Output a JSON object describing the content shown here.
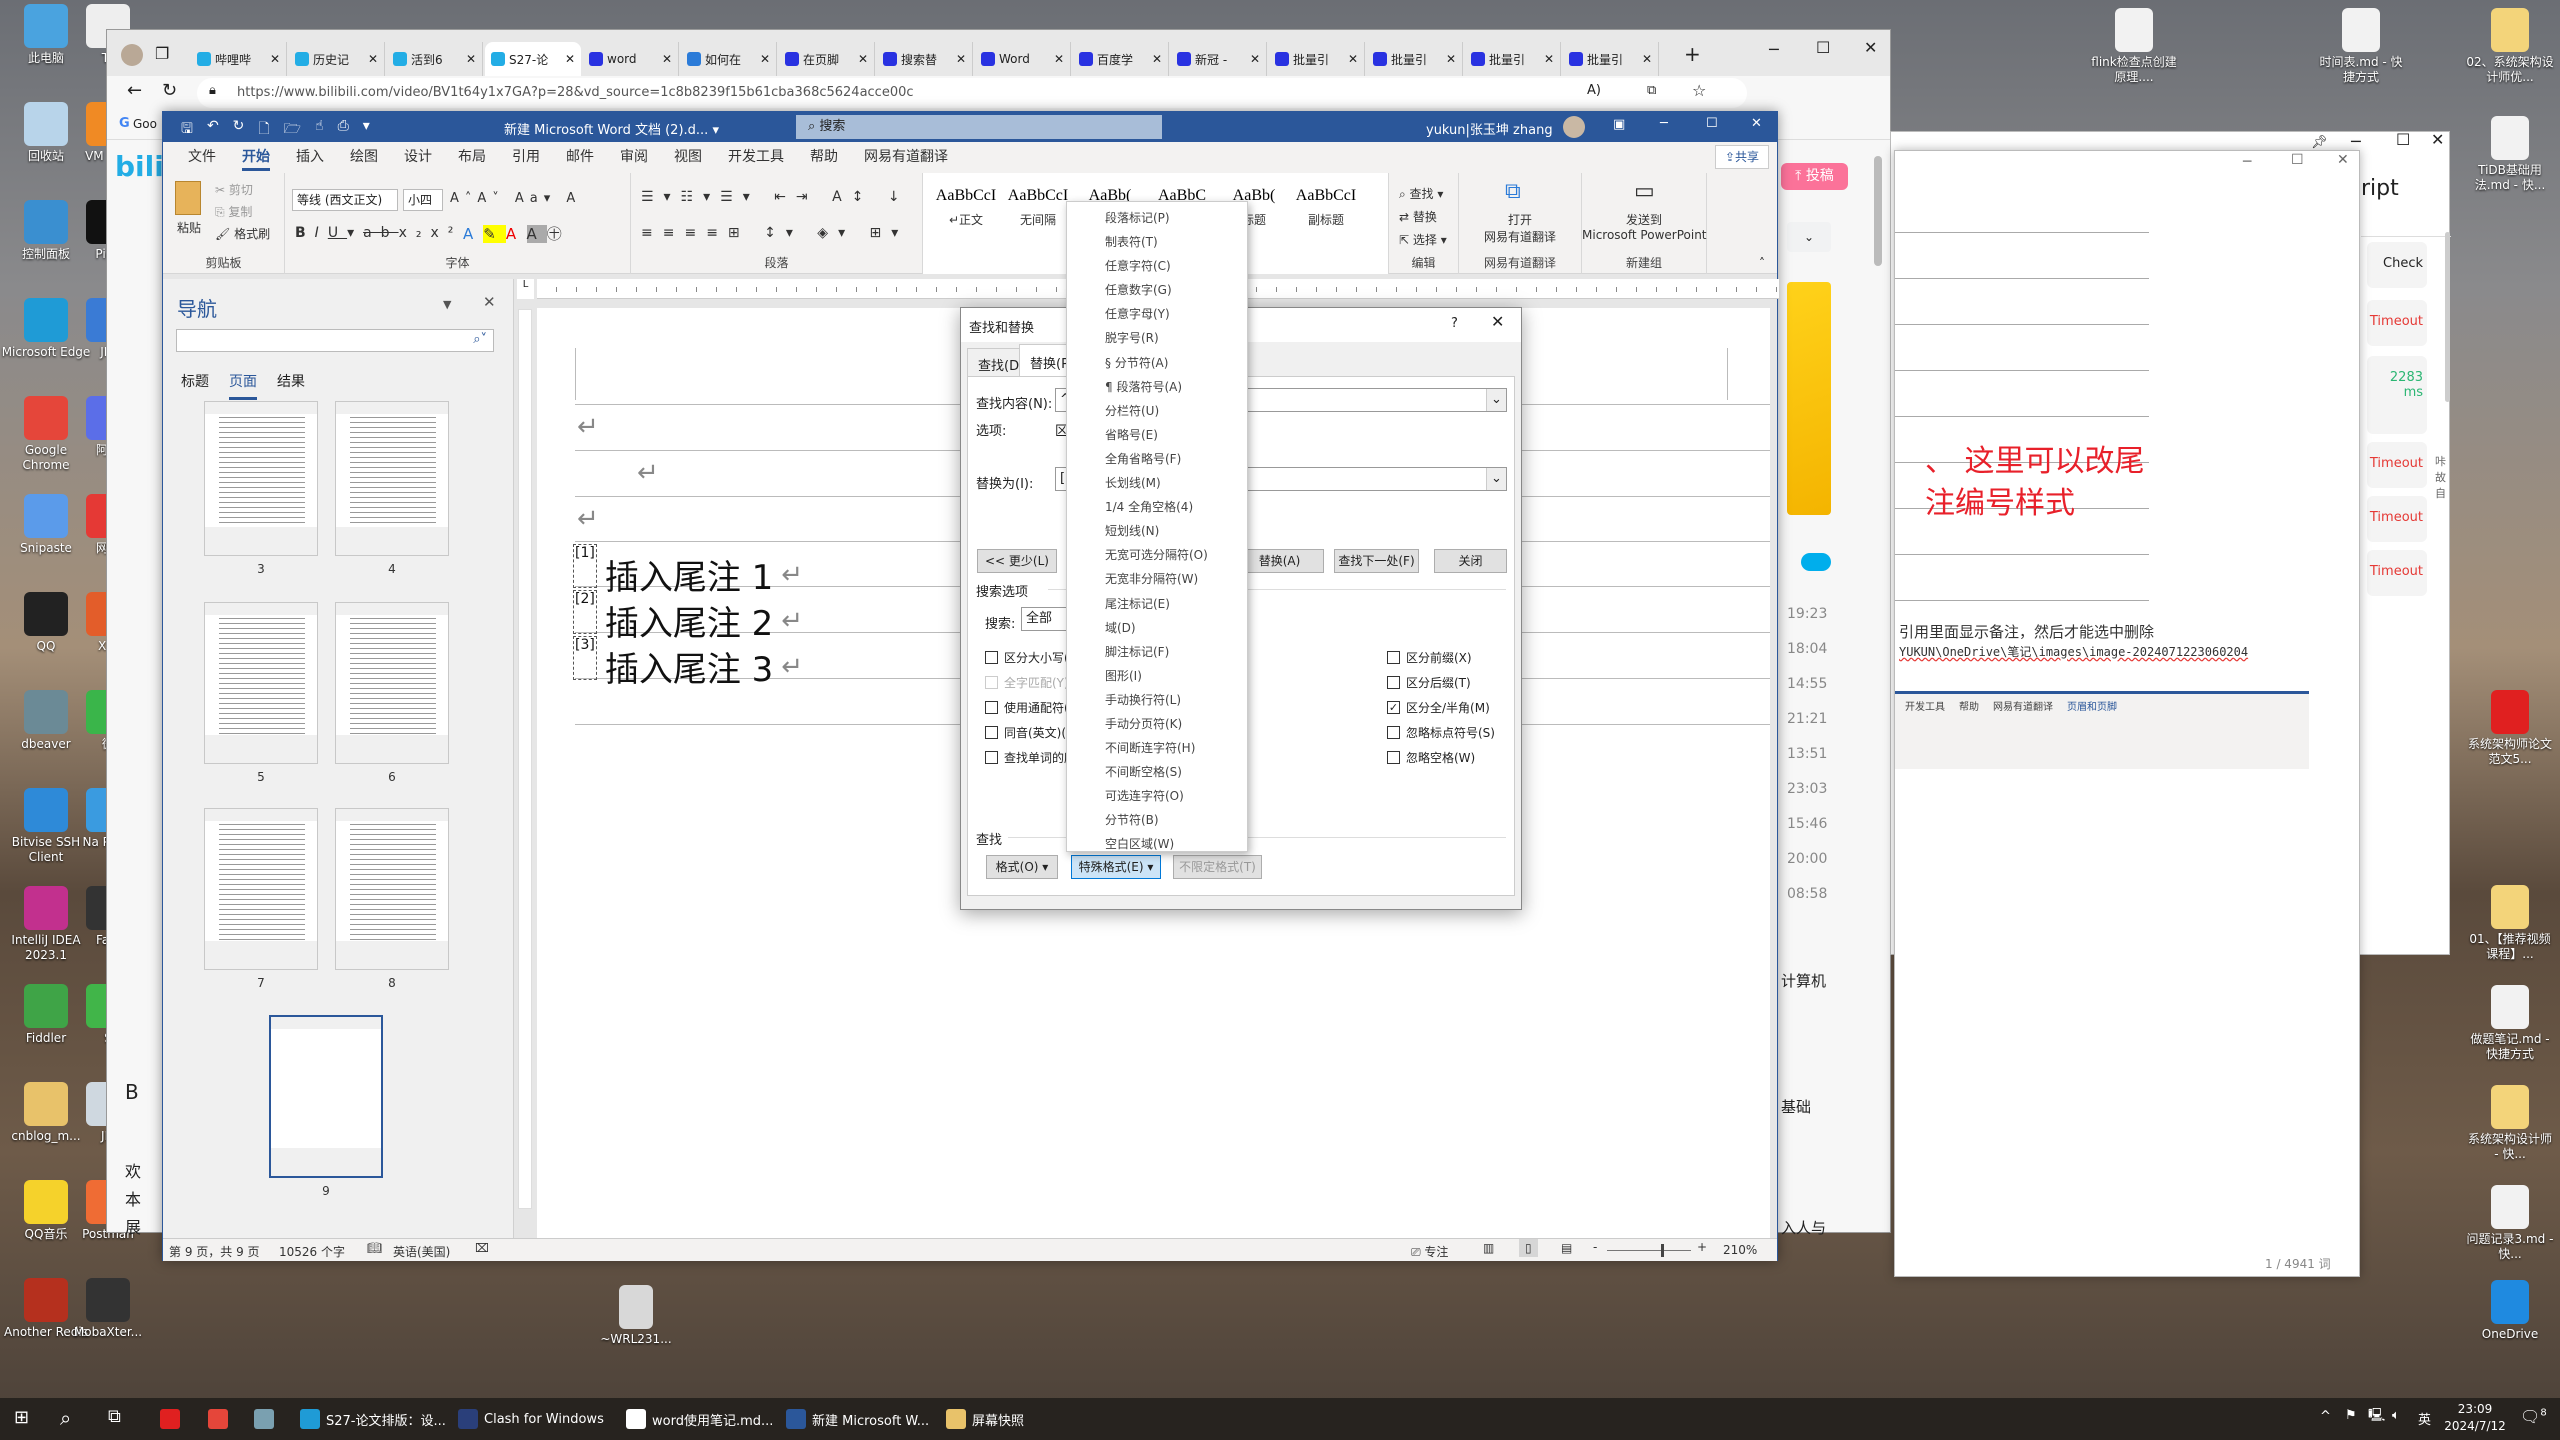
{
  "desktop": {
    "left_icons": [
      {
        "label": "此电脑",
        "color": "#4aa3df"
      },
      {
        "label": "回收站",
        "color": "#b8d4ea"
      },
      {
        "label": "控制面板",
        "color": "#3a8fd0"
      },
      {
        "label": "Microsoft Edge",
        "color": "#1f9bd6"
      },
      {
        "label": "Google Chrome",
        "color": "#e5463a"
      },
      {
        "label": "Snipaste",
        "color": "#5b9bea"
      },
      {
        "label": "QQ",
        "color": "#222222"
      },
      {
        "label": "dbeaver",
        "color": "#6b8a96"
      },
      {
        "label": "Bitvise SSH Client",
        "color": "#2e8ad8"
      },
      {
        "label": "IntelliJ IDEA 2023.1",
        "color": "#c2308e"
      },
      {
        "label": "Fiddler",
        "color": "#3fa447"
      },
      {
        "label": "cnblog_m...",
        "color": "#e8c26a"
      },
      {
        "label": "QQ音乐",
        "color": "#f5d22b"
      },
      {
        "label": "Another Redis",
        "color": "#b5301e"
      }
    ],
    "left_icons_col2": [
      {
        "label": "Ty",
        "color": "#eeeeee"
      },
      {
        "label": "VM Wor",
        "color": "#f08a24"
      },
      {
        "label": "Pigo",
        "color": "#111111"
      },
      {
        "label": "JPr",
        "color": "#3a7bd5"
      },
      {
        "label": "阿里",
        "color": "#5b6ee8"
      },
      {
        "label": "网易",
        "color": "#e53935"
      },
      {
        "label": "Xm",
        "color": "#e35d2a"
      },
      {
        "label": "微",
        "color": "#3ab54a"
      },
      {
        "label": "Na Prem",
        "color": "#3a9be0"
      },
      {
        "label": "Fast",
        "color": "#333333"
      },
      {
        "label": "S",
        "color": "#41b549"
      },
      {
        "label": "JM",
        "color": "#cfd8e0"
      },
      {
        "label": "Postman",
        "color": "#ef6c34"
      },
      {
        "label": "MobaXter...",
        "color": "#333333"
      }
    ],
    "right_icons": [
      {
        "label": "flink检查点创建原理....",
        "color": "#f2f2f2"
      },
      {
        "label": "时间表.md - 快捷方式",
        "color": "#f2f2f2"
      },
      {
        "label": "02、系统架构设计师优...",
        "color": "#f3d47a"
      },
      {
        "label": "TiDB基础用法.md - 快...",
        "color": "#f2f2f2"
      },
      {
        "label": "系统架构师论文范文5...",
        "color": "#e02020"
      },
      {
        "label": "01、【推荐视频课程】...",
        "color": "#f3d47a"
      },
      {
        "label": "做题笔记.md - 快捷方式",
        "color": "#f2f2f2"
      },
      {
        "label": "系统架构设计师 - 快...",
        "color": "#f3d47a"
      },
      {
        "label": "问题记录3.md - 快...",
        "color": "#f2f2f2"
      },
      {
        "label": "OneDrive",
        "color": "#1f8ae0"
      }
    ],
    "wrl_icon": "~WRL231..."
  },
  "browser": {
    "tabs": [
      "哔哩哔",
      "历史记",
      "活到6",
      "S27-论",
      "word",
      "如何在",
      "在页脚",
      "搜索替",
      "Word",
      "百度学",
      "新冠 -",
      "批量引",
      "批量引",
      "批量引",
      "批量引"
    ],
    "active_tab_index": 3,
    "new_tab": "+",
    "url": "https://www.bilibili.com/video/BV1t64y1x7GA?p=28&vd_source=1c8b8239f15b61cba368c5624acce00c",
    "bookmark": "Goo",
    "logo": "bili",
    "upload_label": "投稿",
    "times": [
      "19:23",
      "18:04",
      "14:55",
      "21:21",
      "13:51",
      "23:03",
      "15:46",
      "20:00",
      "08:58"
    ],
    "side_texts": [
      "计算机",
      "基础",
      "入人与"
    ],
    "left_texts": [
      "B",
      "欢",
      "本",
      "展"
    ]
  },
  "word": {
    "title": "新建 Microsoft Word 文档 (2).d...",
    "search_placeholder": "搜索",
    "user": "yukun|张玉坤 zhang",
    "share": "共享",
    "tabs": [
      "文件",
      "开始",
      "插入",
      "绘图",
      "设计",
      "布局",
      "引用",
      "邮件",
      "审阅",
      "视图",
      "开发工具",
      "帮助",
      "网易有道翻译"
    ],
    "active_tab": "开始",
    "ribbon": {
      "clipboard": {
        "paste": "粘贴",
        "cut": "剪切",
        "copy": "复制",
        "format_painter": "格式刷",
        "group": "剪贴板"
      },
      "font": {
        "name": "等线 (西文正文)",
        "size": "小四",
        "group": "字体"
      },
      "paragraph": {
        "group": "段落"
      },
      "styles": [
        {
          "preview": "AaBbCcI",
          "name": "↵正文"
        },
        {
          "preview": "AaBbCcI",
          "name": "无间隔"
        },
        {
          "preview": "AaBb(",
          "name": ""
        },
        {
          "preview": "AaBbC",
          "name": ""
        },
        {
          "preview": "AaBb(",
          "name": "标题"
        },
        {
          "preview": "AaBbCcI",
          "name": "副标题"
        }
      ],
      "editing": {
        "find": "查找",
        "replace": "替换",
        "select": "选择",
        "group": "编辑"
      },
      "youdao": {
        "open": "打开",
        "name": "网易有道翻译",
        "group": "网易有道翻译"
      },
      "newgroup": {
        "send": "发送到",
        "target": "Microsoft PowerPoint",
        "group": "新建组"
      }
    },
    "nav": {
      "title": "导航",
      "search_value": "",
      "tabs": [
        "标题",
        "页面",
        "结果"
      ],
      "active_tab": "页面",
      "pages": [
        "3",
        "4",
        "5",
        "6",
        "7",
        "8",
        "9"
      ],
      "selected_page": "9"
    },
    "doc": {
      "endnotes": [
        {
          "mark": "[1]",
          "text": "插入尾注 1"
        },
        {
          "mark": "[2]",
          "text": "插入尾注 2"
        },
        {
          "mark": "[3]",
          "text": "插入尾注 3"
        }
      ],
      "return_mark": "↵"
    },
    "status": {
      "page": "第 9 页，共 9 页",
      "words": "10526 个字",
      "language": "英语(美国)",
      "focus": "专注",
      "zoom": "210%",
      "zoom_level_percent": 210
    }
  },
  "dialog": {
    "title": "查找和替换",
    "help": "?",
    "tabs": [
      "查找(D)",
      "替换(P)"
    ],
    "active_tab": "替换(P)",
    "find_label": "查找内容(N):",
    "find_value": "^e",
    "options_label": "选项:",
    "options_value": "区",
    "replace_label": "替换为(I):",
    "replace_value": "[^",
    "less_button": "<< 更少(L)",
    "replace_all_button": "替换(A)",
    "find_next_button": "查找下一处(F)",
    "close_button": "关闭",
    "search_options_label": "搜索选项",
    "search_label": "搜索:",
    "search_value": "全部",
    "left_checks": [
      {
        "label": "区分大小写(H)",
        "checked": false,
        "disabled": false
      },
      {
        "label": "全字匹配(Y)",
        "checked": false,
        "disabled": true
      },
      {
        "label": "使用通配符(U)",
        "checked": false,
        "disabled": false
      },
      {
        "label": "同音(英文)(K)",
        "checked": false,
        "disabled": false
      },
      {
        "label": "查找单词的所有形式(英文)(W)",
        "checked": false,
        "disabled": false
      }
    ],
    "right_checks": [
      {
        "label": "区分前缀(X)",
        "checked": false
      },
      {
        "label": "区分后缀(T)",
        "checked": false
      },
      {
        "label": "区分全/半角(M)",
        "checked": true
      },
      {
        "label": "忽略标点符号(S)",
        "checked": false
      },
      {
        "label": "忽略空格(W)",
        "checked": false
      }
    ],
    "find_section_label": "查找",
    "format_button": "格式(O) ▾",
    "special_button": "特殊格式(E) ▾",
    "no_format_button": "不限定格式(T)"
  },
  "special_menu": {
    "items": [
      "段落标记(P)",
      "制表符(T)",
      "任意字符(C)",
      "任意数字(G)",
      "任意字母(Y)",
      "脱字号(R)",
      "§ 分节符(A)",
      "¶ 段落符号(A)",
      "分栏符(U)",
      "省略号(E)",
      "全角省略号(F)",
      "长划线(M)",
      "1/4 全角空格(4)",
      "短划线(N)",
      "无宽可选分隔符(O)",
      "无宽非分隔符(W)",
      "尾注标记(E)",
      "域(D)",
      "脚注标记(F)",
      "图形(I)",
      "手动换行符(L)",
      "手动分页符(K)",
      "不间断连字符(H)",
      "不间断空格(S)",
      "可选连字符(O)",
      "分节符(B)",
      "空白区域(W)"
    ]
  },
  "ping_window": {
    "heading": "ript",
    "rows": [
      {
        "text": "Check",
        "color": "#222222"
      },
      {
        "text": "Timeout",
        "color": "#e53935"
      },
      {
        "text": "2283 ms",
        "color": "#2bb673"
      },
      {
        "text": "Timeout",
        "color": "#e53935"
      },
      {
        "text": "Timeout",
        "color": "#e53935"
      },
      {
        "text": "Timeout",
        "color": "#e53935"
      }
    ],
    "side_text": "咔故自"
  },
  "notes_window": {
    "annotation": "、 这里可以改尾注编号样式",
    "annotation_color": "#e8202a",
    "text_line": "引用里面显示备注，然后才能选中删除",
    "path_line": "YUKUN\\OneDrive\\笔记\\images\\image-2024071223060204",
    "embedded_tabs": [
      "开发工具",
      "帮助",
      "网易有道翻译",
      "页眉和页脚"
    ],
    "word_count": "1 / 4941 词"
  },
  "taskbar": {
    "apps": [
      {
        "label": "",
        "color": "#e02020",
        "icon": "youdao-icon"
      },
      {
        "label": "",
        "color": "#e5463a",
        "icon": "chrome-icon"
      },
      {
        "label": "",
        "color": "#7aa0b0",
        "icon": "app-icon"
      },
      {
        "label": "S27-论文排版：设...",
        "color": "#1f9bd6",
        "icon": "edge-icon"
      },
      {
        "label": "Clash for Windows",
        "color": "#2a3f7a",
        "icon": "clash-icon"
      },
      {
        "label": "word使用笔记.md...",
        "color": "#ffffff",
        "icon": "typora-icon"
      },
      {
        "label": "新建 Microsoft W...",
        "color": "#2b579a",
        "icon": "word-icon"
      },
      {
        "label": "屏幕快照",
        "color": "#e8c26a",
        "icon": "folder-icon"
      }
    ],
    "ime": "英",
    "time": "23:09",
    "date": "2024/7/12",
    "notifications": "8"
  }
}
